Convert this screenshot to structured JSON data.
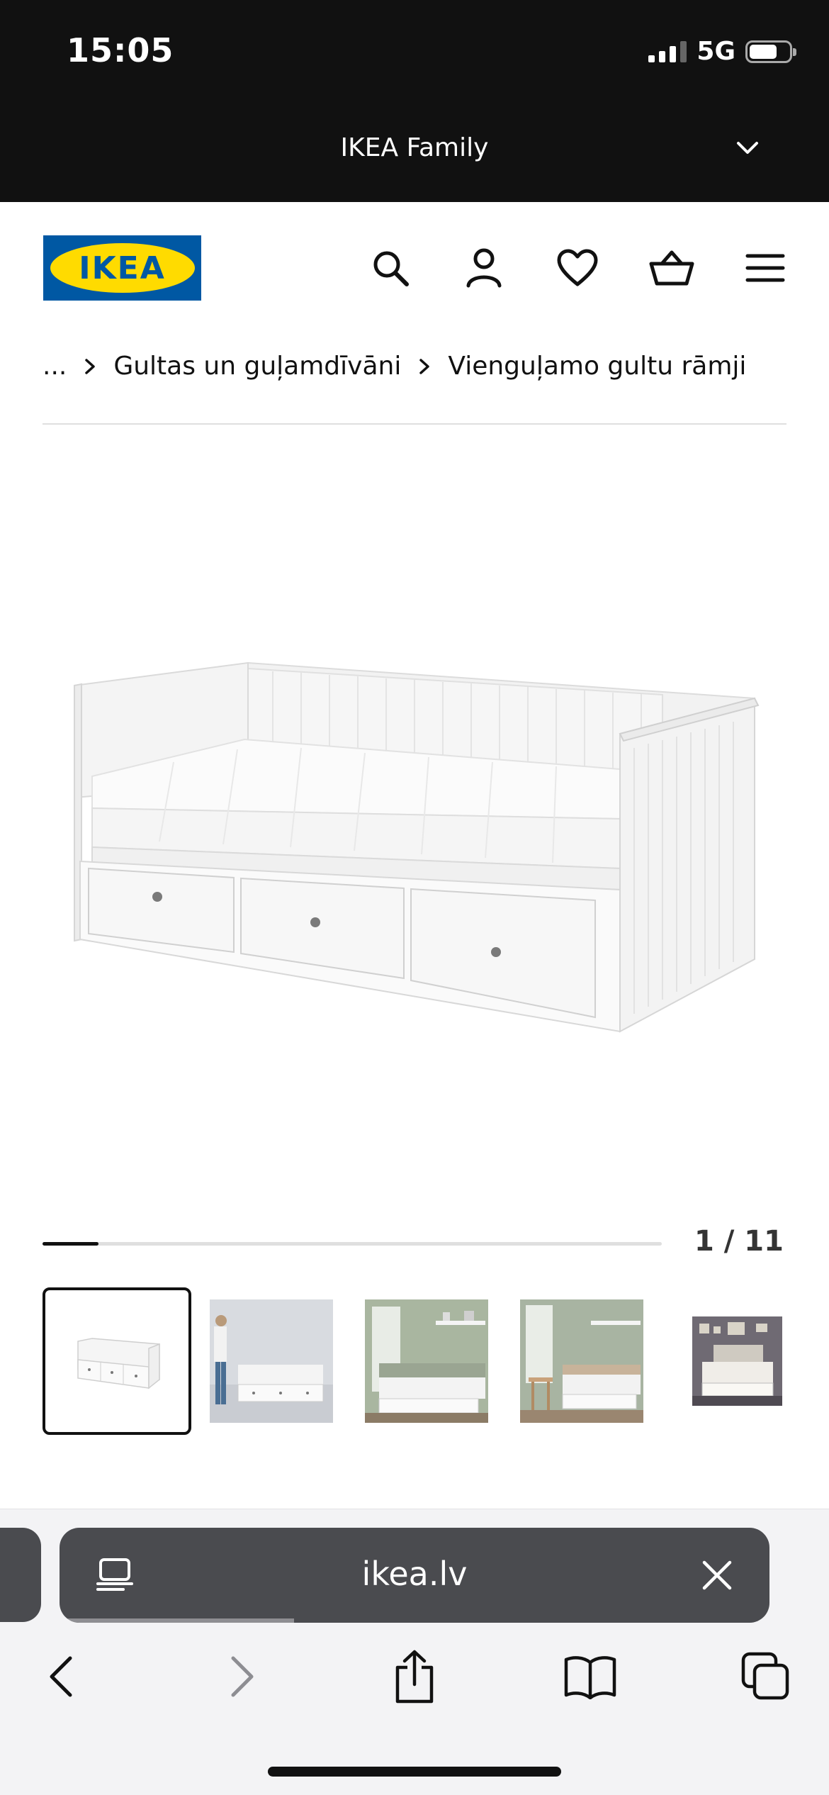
{
  "status_bar": {
    "time": "15:05",
    "network": "5G",
    "battery_level": 0.7
  },
  "family_banner": {
    "title": "IKEA Family"
  },
  "header": {
    "logo_text": "IKEA",
    "icons": [
      "search-icon",
      "account-icon",
      "heart-icon",
      "basket-icon",
      "menu-icon"
    ]
  },
  "breadcrumb": {
    "ellipsis": "...",
    "items": [
      "Gultas un guļamdīvāni",
      "Vienguļamo gultu rāmji"
    ]
  },
  "gallery": {
    "counter": "1 / 11",
    "current": 1,
    "total": 11,
    "progress": 0.09,
    "visible_thumbnails": 5
  },
  "browser": {
    "url": "ikea.lv",
    "load_progress": 0.33,
    "toolbar": [
      "back-icon",
      "forward-icon",
      "share-icon",
      "bookmarks-icon",
      "tabs-icon"
    ]
  },
  "colors": {
    "ikea_blue": "#0058a3",
    "ikea_yellow": "#ffdb00",
    "banner_bg": "#111111",
    "url_bar_bg": "#4a4b4f"
  }
}
